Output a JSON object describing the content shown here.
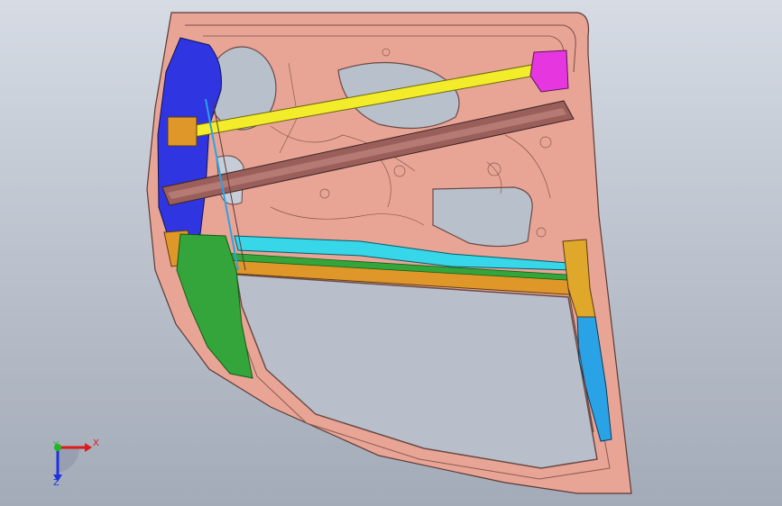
{
  "viewport": {
    "background_top": "#d6dbe4",
    "background_bottom": "#a3abb8"
  },
  "model": {
    "parts": [
      {
        "name": "door-inner-panel",
        "color": "#e8a596"
      },
      {
        "name": "upper-impact-beam",
        "color": "#f2ec2a"
      },
      {
        "name": "diagonal-reinforcement-beam",
        "color": "#9a5f5a"
      },
      {
        "name": "hinge-reinforcement",
        "color": "#2f35e0"
      },
      {
        "name": "lower-front-reinforcement",
        "color": "#34a53a"
      },
      {
        "name": "belt-line-reinforcement",
        "color": "#37d6e8"
      },
      {
        "name": "lower-belt-rail",
        "color": "#e0972a"
      },
      {
        "name": "rear-pillar-reinforcement",
        "color": "#2aa3e6"
      },
      {
        "name": "latch-bracket",
        "color": "#e536e0"
      }
    ]
  },
  "triad": {
    "x_label": "X",
    "y_label": "Y",
    "z_label": "Z",
    "x_color": "#e01919",
    "y_color": "#23b423",
    "z_color": "#1e32e0"
  }
}
